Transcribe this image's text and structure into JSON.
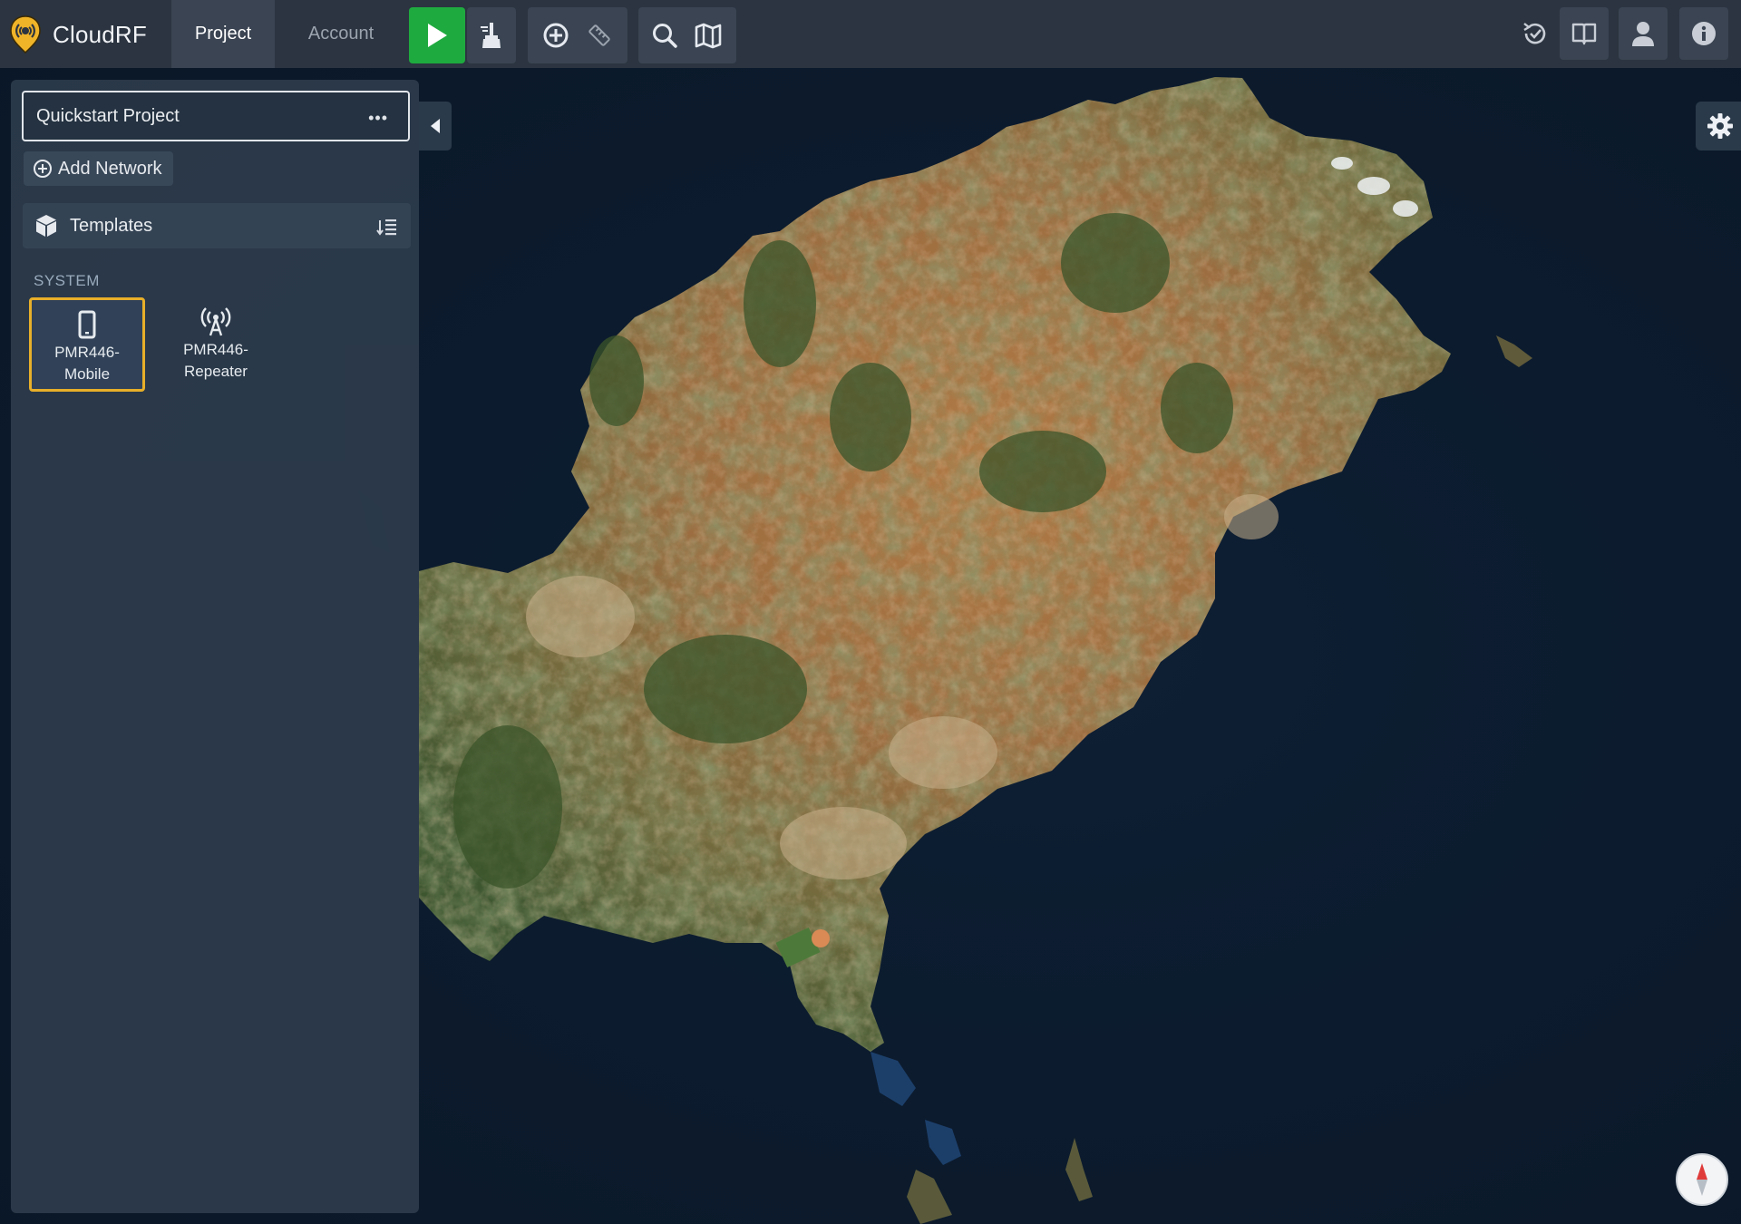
{
  "app": {
    "name": "CloudRF",
    "brand_color": "#f0b429"
  },
  "topbar": {
    "tabs": [
      {
        "label": "Project",
        "active": true
      },
      {
        "label": "Account",
        "active": false
      }
    ],
    "left_tools": [
      "play-icon",
      "broom-icon",
      "plus-circle-icon",
      "ruler-icon",
      "search-icon",
      "map-icon"
    ],
    "right_tools": [
      "history-icon",
      "book-icon",
      "user-icon",
      "info-icon"
    ],
    "run_color": "#1faa3f"
  },
  "sidebar": {
    "project": {
      "title": "Quickstart Project",
      "menu_icon": "ellipsis-icon"
    },
    "add_network_label": "Add Network",
    "templates_label": "Templates",
    "section_label": "SYSTEM",
    "templates": [
      {
        "label": "PMR446-Mobile",
        "icon": "mobile-phone-icon",
        "selected": true
      },
      {
        "label": "PMR446-Repeater",
        "icon": "broadcast-tower-icon",
        "selected": false
      }
    ]
  },
  "map": {
    "imagery": "satellite",
    "water_color": "#0c1b2e",
    "land_colors": [
      "#a8703f",
      "#6b6a3c",
      "#3f5a2c",
      "#c49a6c"
    ]
  }
}
